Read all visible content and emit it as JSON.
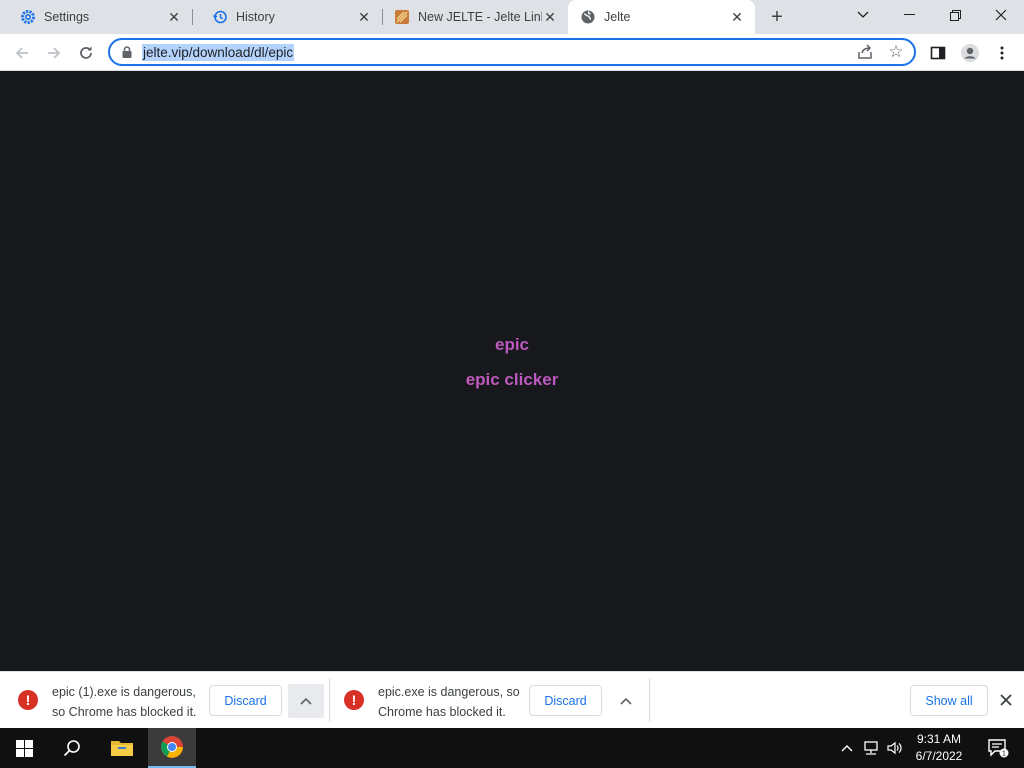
{
  "tabs": [
    {
      "title": "Settings",
      "icon": "gear-icon"
    },
    {
      "title": "History",
      "icon": "history-icon"
    },
    {
      "title": "New JELTE - Jelte Link",
      "icon": "jelte-logo-icon"
    },
    {
      "title": "Jelte",
      "icon": "globe-icon",
      "active": true
    }
  ],
  "toolbar": {
    "url": "jelte.vip/download/dl/epic"
  },
  "page": {
    "heading": "epic",
    "subheading": "epic clicker"
  },
  "downloads": [
    {
      "line1": "epic (1).exe is dangerous,",
      "line2": "so Chrome has blocked it.",
      "discard": "Discard"
    },
    {
      "line1": "epic.exe is dangerous, so",
      "line2": "Chrome has blocked it.",
      "discard": "Discard"
    }
  ],
  "shelf": {
    "show_all": "Show all"
  },
  "taskbar": {
    "time": "9:31 AM",
    "date": "6/7/2022"
  },
  "colors": {
    "accent": "#1a73e8",
    "danger": "#d93025",
    "page_bg": "#17181b",
    "text_gradient_start": "#e0559a",
    "text_gradient_end": "#9b5de5"
  }
}
